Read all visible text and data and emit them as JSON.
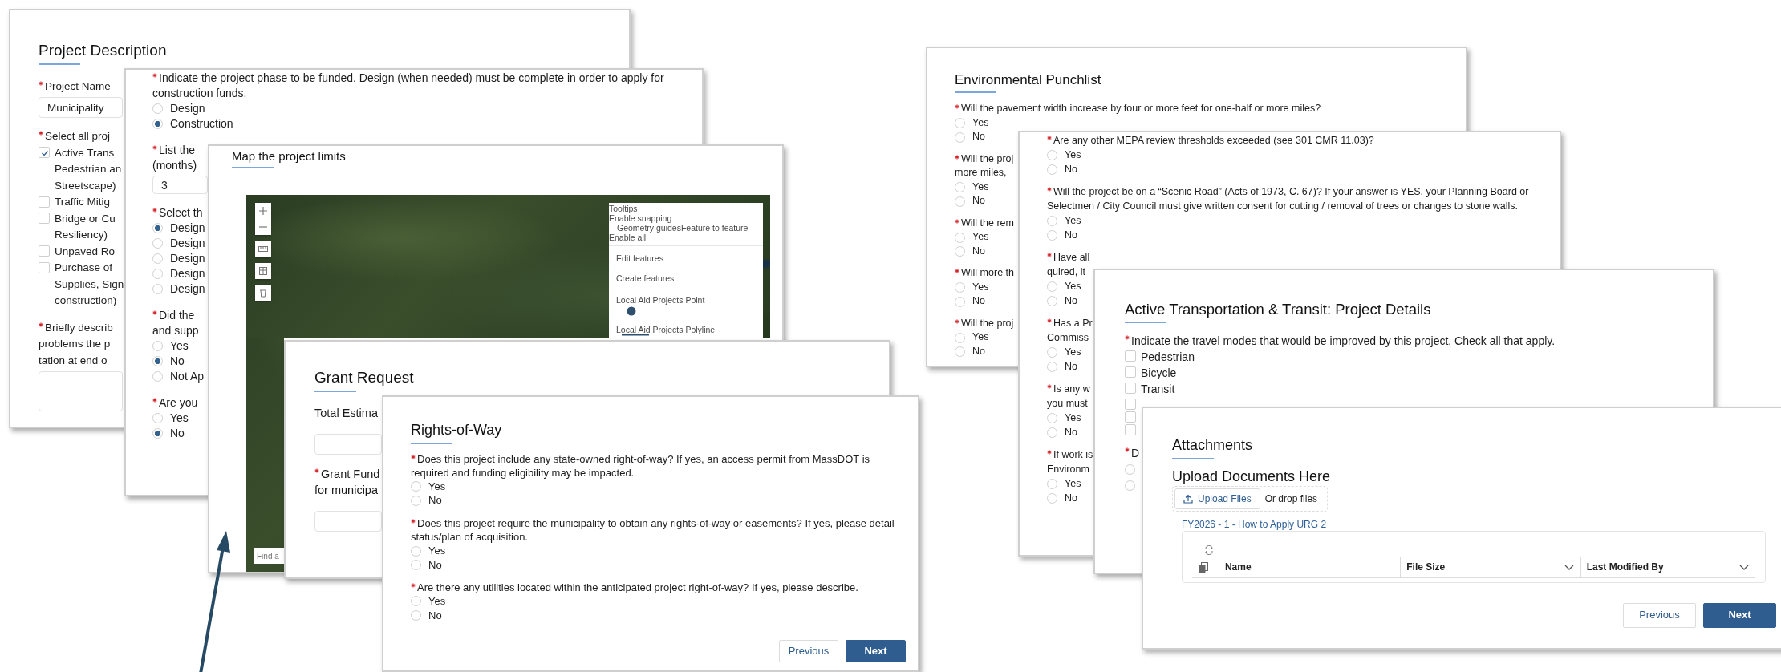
{
  "panels": [
    {
      "title": "Project Description",
      "blocks": [
        {
          "kind": "question",
          "required": true,
          "lines": [
            "Project Name"
          ]
        },
        {
          "kind": "field",
          "value": "Municipality"
        },
        {
          "kind": "question",
          "required": true,
          "lines": [
            "Select all proj"
          ]
        },
        {
          "kind": "checkboxes",
          "options": [
            {
              "lines": [
                "Active Trans",
                "Pedestrian an",
                "Streetscape)"
              ],
              "checked": true
            },
            {
              "lines": [
                "Traffic Mitig"
              ],
              "checked": false
            },
            {
              "lines": [
                "Bridge or Cu",
                "Resiliency)"
              ],
              "checked": false
            },
            {
              "lines": [
                "Unpaved Ro"
              ],
              "checked": false
            },
            {
              "lines": [
                "Purchase of",
                "Supplies, Sign",
                "construction)"
              ],
              "checked": false
            }
          ]
        },
        {
          "kind": "question",
          "required": true,
          "lines": [
            "Briefly describ",
            "problems the p",
            "tation at end o"
          ]
        },
        {
          "kind": "textarea"
        }
      ]
    },
    {
      "blocks": [
        {
          "kind": "question",
          "required": true,
          "text": "Indicate the project phase to be funded. Design (when needed) must be complete in order to apply for construction funds."
        },
        {
          "kind": "radios",
          "options": [
            {
              "label": "Design",
              "selected": false
            },
            {
              "label": "Construction",
              "selected": true
            }
          ]
        },
        {
          "kind": "question",
          "required": true,
          "lines": [
            "List the",
            "(months)"
          ]
        },
        {
          "kind": "field",
          "value": "3"
        },
        {
          "kind": "question",
          "required": true,
          "lines": [
            "Select th"
          ]
        },
        {
          "kind": "radios",
          "options": [
            {
              "label": "Design",
              "selected": true
            },
            {
              "label": "Design",
              "selected": false
            },
            {
              "label": "Design",
              "selected": false
            },
            {
              "label": "Design",
              "selected": false
            },
            {
              "label": "Design",
              "selected": false
            }
          ]
        },
        {
          "kind": "question",
          "required": true,
          "lines": [
            "Did the",
            "and supp"
          ]
        },
        {
          "kind": "radios",
          "options": [
            {
              "label": "Yes",
              "selected": false
            },
            {
              "label": "No",
              "selected": true
            },
            {
              "label": "Not Ap",
              "selected": false
            }
          ]
        },
        {
          "kind": "question",
          "required": true,
          "lines": [
            "Are you"
          ]
        },
        {
          "kind": "radios",
          "options": [
            {
              "label": "Yes",
              "selected": false
            },
            {
              "label": "No",
              "selected": true
            }
          ]
        }
      ]
    },
    {
      "title": "Map the project limits",
      "blocks": [
        {
          "kind": "map",
          "search": {
            "placeholder": "Find a"
          },
          "editor": {
            "options": [
              {
                "label": "Tooltips"
              },
              {
                "label": "Enable snapping",
                "children": [
                  {
                    "label": "Geometry guidesFeature to feature"
                  }
                ]
              },
              {
                "label": "Enable all"
              }
            ],
            "actions": [
              "Edit features",
              "Create features"
            ],
            "layers": [
              {
                "label": "Local Aid Projects Point",
                "kind": "point"
              },
              {
                "label": "Local Aid Projects Polyline",
                "kind": "line"
              }
            ]
          }
        }
      ]
    },
    {
      "title": "Grant Request",
      "blocks": [
        {
          "kind": "question",
          "required": false,
          "lines": [
            "Total Estima"
          ]
        },
        {
          "kind": "field"
        },
        {
          "kind": "question",
          "required": true,
          "lines": [
            "Grant Fund",
            "for municipa"
          ]
        },
        {
          "kind": "field"
        }
      ]
    },
    {
      "title": "Rights-of-Way",
      "blocks": [
        {
          "kind": "question",
          "required": true,
          "text": "Does this project include any state-owned right-of-way? If yes, an access permit from MassDOT is required and funding eligibility may be impacted."
        },
        {
          "kind": "radios",
          "options": [
            {
              "label": "Yes",
              "selected": false
            },
            {
              "label": "No",
              "selected": false
            }
          ]
        },
        {
          "kind": "question",
          "required": true,
          "text": "Does this project require the municipality to obtain any rights-of-way or easements? If yes, please detail status/plan of acquisition."
        },
        {
          "kind": "radios",
          "options": [
            {
              "label": "Yes",
              "selected": false
            },
            {
              "label": "No",
              "selected": false
            }
          ]
        },
        {
          "kind": "question",
          "required": true,
          "text": "Are there any utilities located within the anticipated project right-of-way? If yes, please describe."
        },
        {
          "kind": "radios",
          "options": [
            {
              "label": "Yes",
              "selected": false
            },
            {
              "label": "No",
              "selected": false
            }
          ]
        },
        {
          "kind": "buttons",
          "buttons": [
            {
              "label": "Previous",
              "primary": false
            },
            {
              "label": "Next",
              "primary": true
            }
          ]
        }
      ]
    },
    {
      "title": "Environmental Punchlist",
      "blocks": [
        {
          "kind": "question",
          "required": true,
          "text": "Will the pavement width increase by four or more feet for one-half or more miles?"
        },
        {
          "kind": "radios",
          "options": [
            {
              "label": "Yes",
              "selected": false
            },
            {
              "label": "No",
              "selected": false
            }
          ]
        },
        {
          "kind": "question",
          "required": true,
          "lines": [
            "Will the proj",
            "more miles,"
          ]
        },
        {
          "kind": "radios",
          "options": [
            {
              "label": "Yes",
              "selected": false
            },
            {
              "label": "No",
              "selected": false
            }
          ]
        },
        {
          "kind": "question",
          "required": true,
          "lines": [
            "Will the rem"
          ]
        },
        {
          "kind": "radios",
          "options": [
            {
              "label": "Yes",
              "selected": false
            },
            {
              "label": "No",
              "selected": false
            }
          ]
        },
        {
          "kind": "question",
          "required": true,
          "lines": [
            "Will more th"
          ]
        },
        {
          "kind": "radios",
          "options": [
            {
              "label": "Yes",
              "selected": false
            },
            {
              "label": "No",
              "selected": false
            }
          ]
        },
        {
          "kind": "question",
          "required": true,
          "lines": [
            "Will the proj"
          ]
        },
        {
          "kind": "radios",
          "options": [
            {
              "label": "Yes",
              "selected": false
            },
            {
              "label": "No",
              "selected": false
            }
          ]
        }
      ]
    },
    {
      "blocks": [
        {
          "kind": "question",
          "required": true,
          "text": "Are any other MEPA review thresholds exceeded (see 301 CMR 11.03)?"
        },
        {
          "kind": "radios",
          "options": [
            {
              "label": "Yes",
              "selected": false
            },
            {
              "label": "No",
              "selected": false
            }
          ]
        },
        {
          "kind": "question",
          "required": true,
          "text": "Will the project be on a “Scenic Road” (Acts of 1973, C. 67)? If your answer is YES, your Planning Board or Selectmen / City Council must give written consent for cutting / removal of trees or changes to stone walls."
        },
        {
          "kind": "radios",
          "options": [
            {
              "label": "Yes",
              "selected": false
            },
            {
              "label": "No",
              "selected": false
            }
          ]
        },
        {
          "kind": "question",
          "required": true,
          "lines": [
            "Have all",
            "quired, it"
          ]
        },
        {
          "kind": "radios",
          "options": [
            {
              "label": "Yes",
              "selected": false
            },
            {
              "label": "No",
              "selected": false
            }
          ]
        },
        {
          "kind": "question",
          "required": true,
          "lines": [
            "Has a Pr",
            "Commiss"
          ]
        },
        {
          "kind": "radios",
          "options": [
            {
              "label": "Yes",
              "selected": false
            },
            {
              "label": "No",
              "selected": false
            }
          ]
        },
        {
          "kind": "question",
          "required": true,
          "lines": [
            "Is any w",
            "you must"
          ]
        },
        {
          "kind": "radios",
          "options": [
            {
              "label": "Yes",
              "selected": false
            },
            {
              "label": "No",
              "selected": false
            }
          ]
        },
        {
          "kind": "question",
          "required": true,
          "lines": [
            "If work is",
            "Environm"
          ]
        },
        {
          "kind": "radios",
          "options": [
            {
              "label": "Yes",
              "selected": false
            },
            {
              "label": "No",
              "selected": false
            }
          ]
        }
      ]
    },
    {
      "title": "Active Transportation & Transit: Project Details",
      "blocks": [
        {
          "kind": "question",
          "required": true,
          "text": "Indicate the travel modes that would be improved by this project. Check all that apply."
        },
        {
          "kind": "checkboxes",
          "options": [
            {
              "lines": [
                "Pedestrian"
              ],
              "checked": false
            },
            {
              "lines": [
                "Bicycle"
              ],
              "checked": false
            },
            {
              "lines": [
                "Transit"
              ],
              "checked": false
            },
            {
              "checked": false
            },
            {
              "checked": false
            },
            {
              "checked": false
            }
          ]
        },
        {
          "kind": "question",
          "required": true,
          "lines": [
            "D"
          ]
        },
        {
          "kind": "radios",
          "options": [
            {
              "selected": false
            },
            {
              "selected": false
            }
          ]
        }
      ]
    },
    {
      "title": "Attachments",
      "blocks": [
        {
          "kind": "subheading",
          "text": "Upload Documents Here"
        },
        {
          "kind": "upload",
          "button": "Upload Files",
          "hint": "Or drop files"
        },
        {
          "kind": "link",
          "text": "FY2026 - 1 - How to Apply URG 2"
        },
        {
          "kind": "file-table",
          "columns": [
            {
              "label": "Name",
              "sortable": false
            },
            {
              "label": "File Size",
              "sortable": true
            },
            {
              "label": "Last Modified By",
              "sortable": true
            }
          ]
        },
        {
          "kind": "buttons",
          "buttons": [
            {
              "label": "Previous",
              "primary": false
            },
            {
              "label": "Next",
              "primary": true
            }
          ]
        }
      ]
    }
  ]
}
